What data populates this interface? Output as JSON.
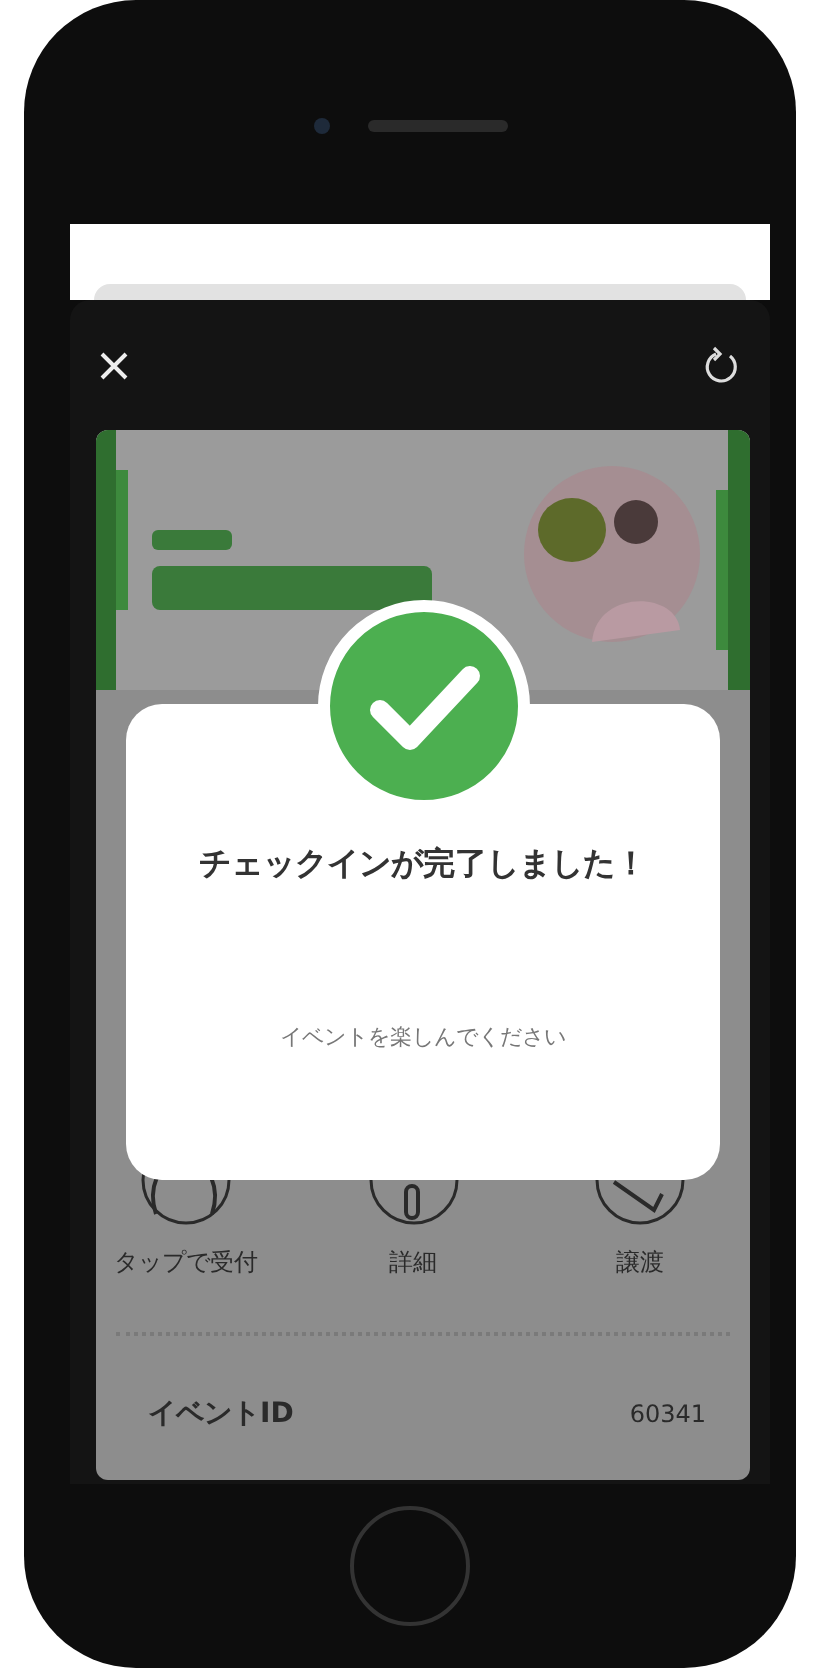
{
  "ticket": {
    "actions": [
      {
        "label": "タップで受付",
        "kind": "hand"
      },
      {
        "label": "詳細",
        "kind": "info"
      },
      {
        "label": "譲渡",
        "kind": "transfer"
      }
    ],
    "event_id": {
      "label": "イベントID",
      "value": "60341"
    }
  },
  "dialog": {
    "title": "チェックインが完了しました！",
    "message": "イベントを楽しんでください"
  }
}
